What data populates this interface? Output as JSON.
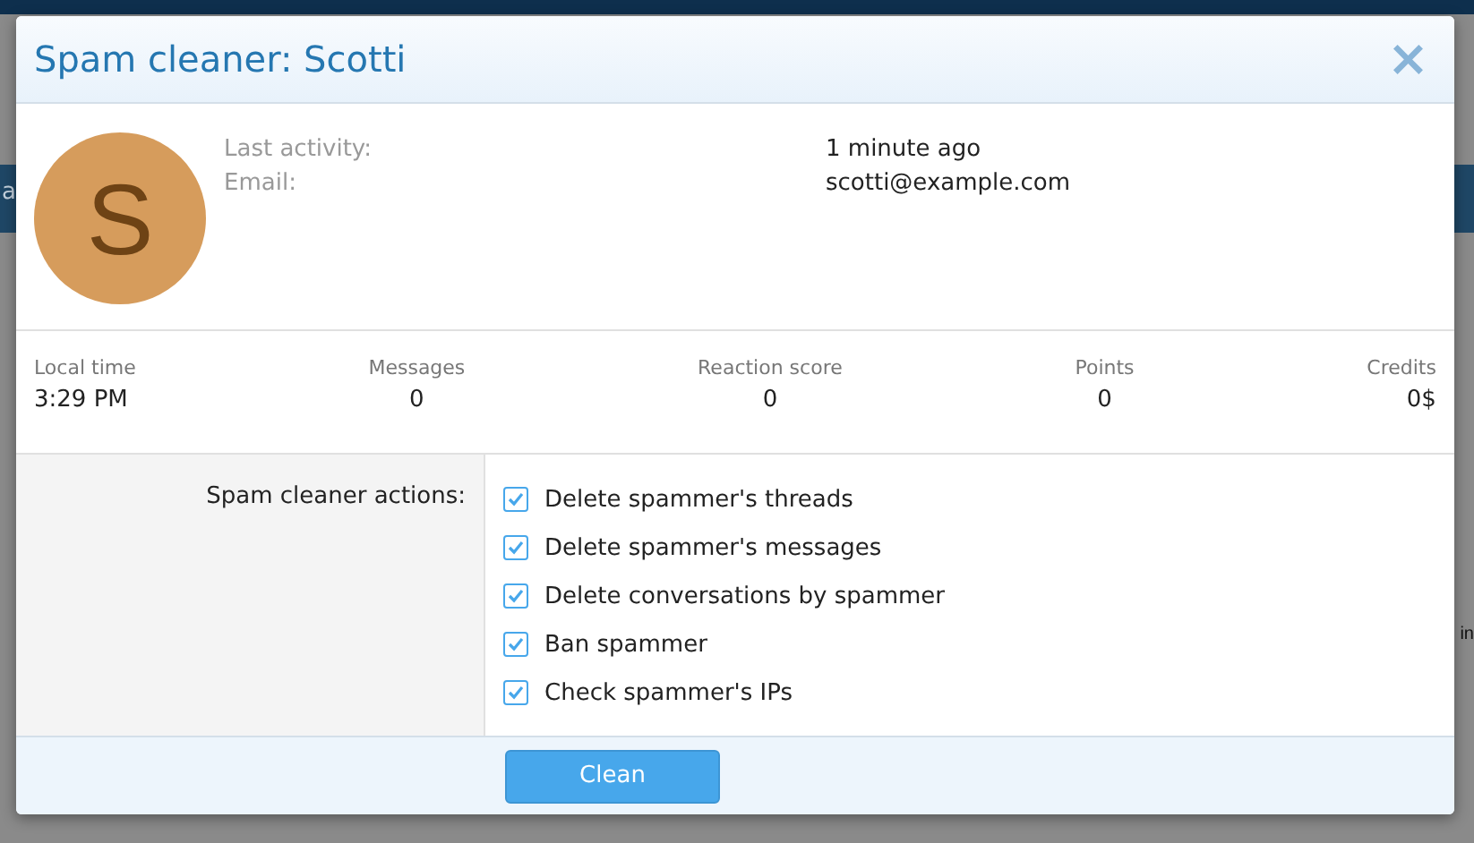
{
  "backdrop": {
    "fragments": [
      {
        "text": "a",
        "kind": "band"
      },
      {
        "text": "in",
        "kind": "page"
      }
    ]
  },
  "dialog": {
    "title": "Spam cleaner: Scotti",
    "close": "×",
    "avatar": {
      "letter": "S",
      "color": "#d69c5c"
    },
    "info": [
      {
        "label": "Last activity:",
        "value": "1 minute ago"
      },
      {
        "label": "Email:",
        "value": "scotti@example.com"
      }
    ],
    "stats": [
      {
        "label": "Local time",
        "value": "3:29 PM"
      },
      {
        "label": "Messages",
        "value": "0"
      },
      {
        "label": "Reaction score",
        "value": "0"
      },
      {
        "label": "Points",
        "value": "0"
      },
      {
        "label": "Credits",
        "value": "0$"
      }
    ],
    "actions_label": "Spam cleaner actions:",
    "actions": [
      {
        "label": "Delete spammer's threads",
        "checked": true
      },
      {
        "label": "Delete spammer's messages",
        "checked": true
      },
      {
        "label": "Delete conversations by spammer",
        "checked": true
      },
      {
        "label": "Ban spammer",
        "checked": true
      },
      {
        "label": "Check spammer's IPs",
        "checked": true
      }
    ],
    "button": "Clean"
  }
}
